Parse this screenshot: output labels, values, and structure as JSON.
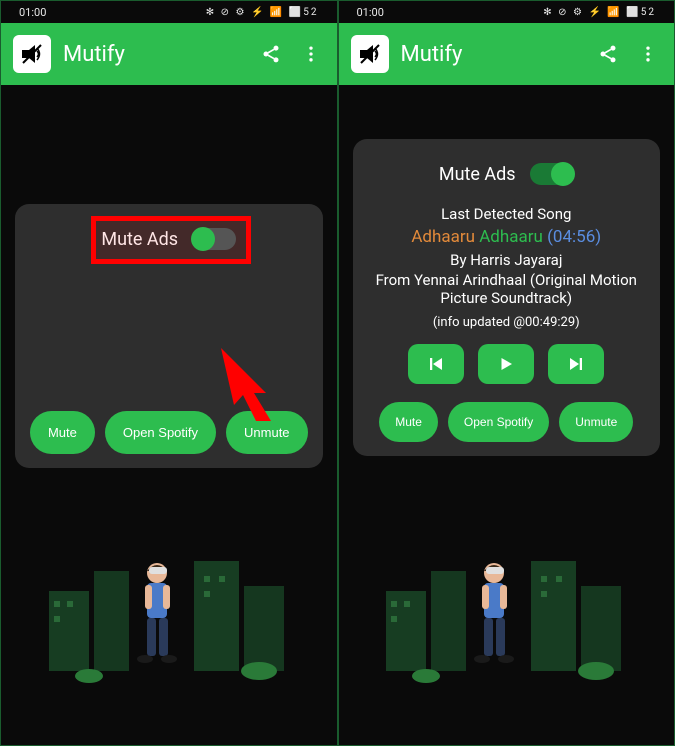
{
  "status": {
    "time": "01:00",
    "icons": "✻ ⊘ ⚙ ⚡ 📶 ⬜52"
  },
  "app": {
    "title": "Mutify"
  },
  "left": {
    "toggle_label": "Mute Ads",
    "toggle_on": false,
    "buttons": {
      "mute": "Mute",
      "open": "Open Spotify",
      "unmute": "Unmute"
    }
  },
  "right": {
    "toggle_label": "Mute Ads",
    "toggle_on": true,
    "song": {
      "header": "Last Detected Song",
      "title_w1": "Adhaaru",
      "title_w2": "Adhaaru",
      "duration": "(04:56)",
      "by": "By Harris Jayaraj",
      "from": "From Yennai Arindhaal (Original Motion Picture Soundtrack)",
      "updated": "(info updated @00:49:29)"
    },
    "buttons": {
      "mute": "Mute",
      "open": "Open Spotify",
      "unmute": "Unmute"
    }
  }
}
